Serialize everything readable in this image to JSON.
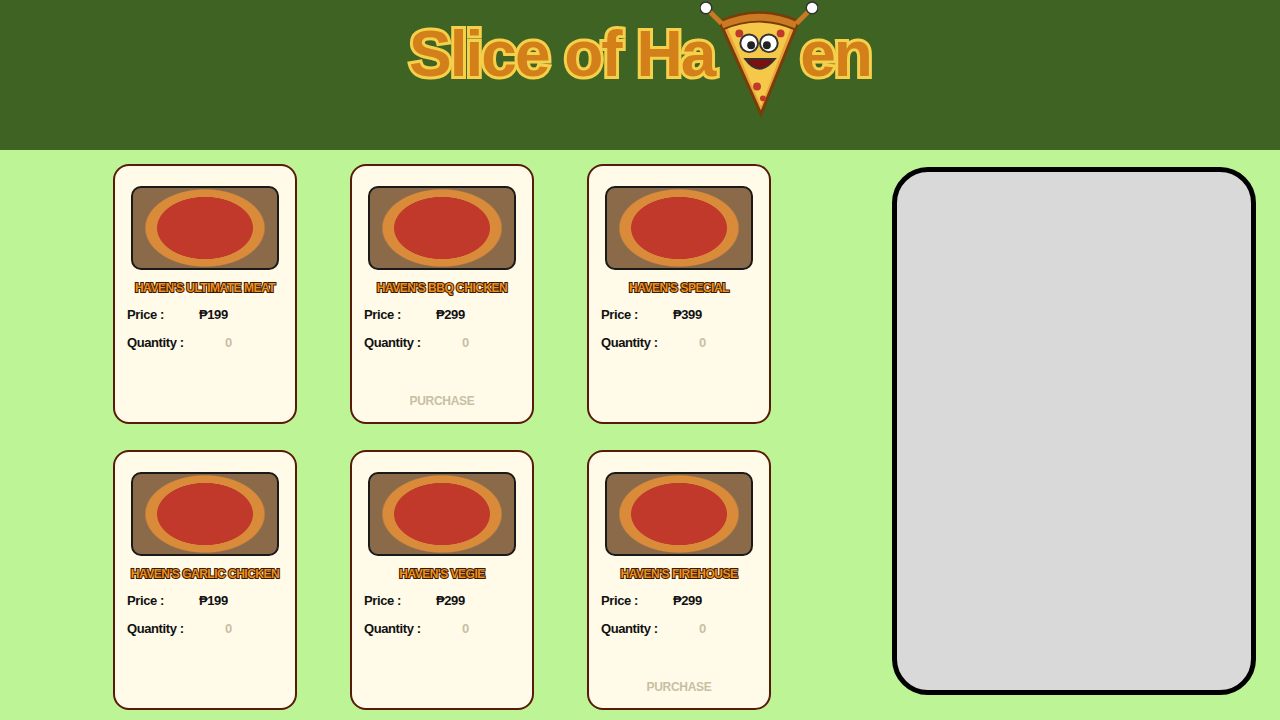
{
  "header": {
    "logo_before": "Slice of Ha",
    "logo_after": "en"
  },
  "products": [
    {
      "name": "HAVEN'S ULTIMATE MEAT",
      "price_label": "Price :",
      "price": "₱199",
      "quantity_label": "Quantity :",
      "quantity": "0"
    },
    {
      "name": "HAVEN'S BBQ CHICKEN",
      "price_label": "Price :",
      "price": "₱299",
      "quantity_label": "Quantity :",
      "quantity": "0",
      "purchase": "PURCHASE"
    },
    {
      "name": "HAVEN'S SPECIAL",
      "price_label": "Price :",
      "price": "₱399",
      "quantity_label": "Quantity :",
      "quantity": "0"
    },
    {
      "name": "HAVEN'S GARLIC CHICKEN",
      "price_label": "Price :",
      "price": "₱199",
      "quantity_label": "Quantity :",
      "quantity": "0"
    },
    {
      "name": "HAVEN'S VEGIE",
      "price_label": "Price :",
      "price": "₱299",
      "quantity_label": "Quantity :",
      "quantity": "0"
    },
    {
      "name": "HAVEN'S FIREHOUSE",
      "price_label": "Price :",
      "price": "₱299",
      "quantity_label": "Quantity :",
      "quantity": "0",
      "purchase": "PURCHASE"
    }
  ]
}
